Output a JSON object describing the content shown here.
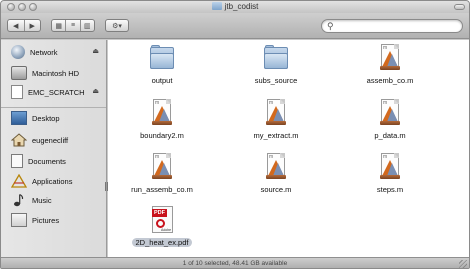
{
  "window": {
    "title": "jtb_codist"
  },
  "toolbar": {
    "back_glyph": "◀",
    "forward_glyph": "▶",
    "view_icon_glyph": "▦",
    "view_list_glyph": "≡",
    "view_column_glyph": "▥",
    "action_glyph": "⚙▾",
    "search_glyph": "⚲",
    "search_value": ""
  },
  "sidebar": {
    "eject_glyph": "⏏",
    "devices": [
      {
        "label": "Network",
        "icon": "network-globe-icon",
        "ejectable": true
      },
      {
        "label": "Macintosh HD",
        "icon": "hard-drive-icon",
        "ejectable": false
      },
      {
        "label": "EMC_SCRATCH",
        "icon": "disk-image-icon",
        "ejectable": true
      }
    ],
    "places": [
      {
        "label": "Desktop",
        "icon": "desktop-icon"
      },
      {
        "label": "eugenecliff",
        "icon": "home-icon"
      },
      {
        "label": "Documents",
        "icon": "documents-icon"
      },
      {
        "label": "Applications",
        "icon": "applications-icon"
      },
      {
        "label": "Music",
        "icon": "music-icon"
      },
      {
        "label": "Pictures",
        "icon": "pictures-icon"
      }
    ]
  },
  "files": [
    {
      "name": "output",
      "type": "folder",
      "selected": false
    },
    {
      "name": "subs_source",
      "type": "folder",
      "selected": false
    },
    {
      "name": "assemb_co.m",
      "type": "m-file",
      "selected": false
    },
    {
      "name": "boundary2.m",
      "type": "m-file",
      "selected": false
    },
    {
      "name": "my_extract.m",
      "type": "m-file",
      "selected": false
    },
    {
      "name": "p_data.m",
      "type": "m-file",
      "selected": false
    },
    {
      "name": "run_assemb_co.m",
      "type": "m-file",
      "selected": false
    },
    {
      "name": "source.m",
      "type": "m-file",
      "selected": false
    },
    {
      "name": "steps.m",
      "type": "m-file",
      "selected": false
    },
    {
      "name": "2D_heat_ex.pdf",
      "type": "pdf",
      "selected": true,
      "badge": "PDF",
      "brand": "Adobe"
    }
  ],
  "m_file_mark": "m",
  "status": {
    "text": "1 of 10 selected, 48.41 GB available"
  },
  "colors": {
    "selection": "#c3c9d3",
    "folder": "#98b6d6",
    "pdf_red": "#c8121c",
    "matlab_orange": "#d2691e"
  }
}
